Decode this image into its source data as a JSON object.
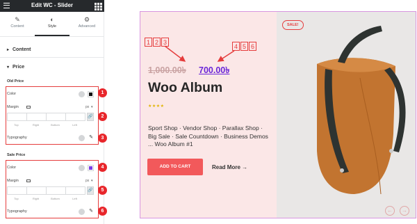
{
  "panel": {
    "title": "Edit WC - Slider",
    "tabs": [
      {
        "label": "Content",
        "icon": "pencil-icon"
      },
      {
        "label": "Style",
        "icon": "half-circle-icon"
      },
      {
        "label": "Advanced",
        "icon": "gear-icon"
      }
    ],
    "sections": {
      "content": "Content",
      "price": "Price"
    },
    "old_price": {
      "heading": "Old Price",
      "color_label": "Color",
      "color_value": "#111111",
      "margin_label": "Margin",
      "unit": "px",
      "sub_labels": [
        "Top",
        "Right",
        "Bottom",
        "Left"
      ],
      "typography_label": "Typography"
    },
    "sale_price": {
      "heading": "Sale Price",
      "color_label": "Color",
      "color_value": "#7b3fe4",
      "margin_label": "Margin",
      "unit": "px",
      "sub_labels": [
        "Top",
        "Right",
        "Bottom",
        "Left"
      ],
      "typography_label": "Typography"
    },
    "badges": [
      "1",
      "2",
      "3",
      "4",
      "5",
      "6"
    ]
  },
  "preview": {
    "old_price": "1,000.00৳",
    "sale_price": "700.00৳",
    "old_markers": [
      "1",
      "2",
      "3"
    ],
    "sale_markers": [
      "4",
      "5",
      "6"
    ],
    "title": "Woo Album",
    "stars": "★★★★",
    "description": "Sport Shop · Vendor Shop · Parallax Shop · Big Sale · Sale Countdown · Business Demos ... Woo Album #1",
    "cart_button": "ADD TO CART",
    "read_more": "Read More",
    "sale_badge": "SALE!",
    "colors": {
      "accent": "#f2595b",
      "sale_price": "#6a25d8",
      "annotation": "#e53c3c"
    }
  }
}
